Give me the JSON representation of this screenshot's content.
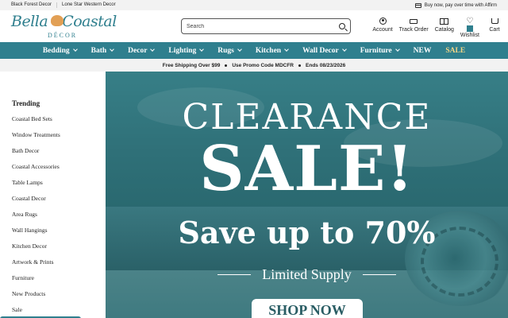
{
  "topbar": {
    "sites": [
      "Black Forest Decor",
      "Lone Star Western Decor"
    ],
    "affirm_text": "Buy now, pay over time with Affirm"
  },
  "header": {
    "logo": {
      "line1a": "Bella",
      "line1b": "Coastal",
      "line2": "DÉCOR"
    },
    "search": {
      "placeholder": "Search",
      "value": ""
    },
    "icons": [
      {
        "label": "Account",
        "icon": "account-icon"
      },
      {
        "label": "Track Order",
        "icon": "truck-icon"
      },
      {
        "label": "Catalog",
        "icon": "catalog-icon"
      },
      {
        "label": "Wishlist",
        "icon": "heart-icon"
      },
      {
        "label": "Cart",
        "icon": "cart-icon"
      }
    ]
  },
  "nav": {
    "items": [
      {
        "label": "Bedding"
      },
      {
        "label": "Bath"
      },
      {
        "label": "Decor"
      },
      {
        "label": "Lighting"
      },
      {
        "label": "Rugs"
      },
      {
        "label": "Kitchen"
      },
      {
        "label": "Wall Decor"
      },
      {
        "label": "Furniture"
      },
      {
        "label": "NEW"
      },
      {
        "label": "SALE"
      }
    ],
    "bg_color": "#2f7f8e",
    "sale_color": "#f3d586"
  },
  "promo": {
    "parts": [
      "Free Shipping Over $99",
      "Use Promo Code MDCFR",
      "Ends 08/23/2026"
    ]
  },
  "sidebar": {
    "heading": "Trending",
    "links": [
      "Coastal Bed Sets",
      "Window Treatments",
      "Bath Decor",
      "Coastal Accessories",
      "Table Lamps",
      "Coastal Decor",
      "Area Rugs",
      "Wall Hangings",
      "Kitchen Decor",
      "Artwork & Prints",
      "Furniture",
      "New Products",
      "Sale"
    ]
  },
  "hero": {
    "line1": "CLEARANCE",
    "line2": "SALE!",
    "line3": "Save up to 70%",
    "line4": "Limited Supply",
    "cta": "SHOP NOW"
  }
}
